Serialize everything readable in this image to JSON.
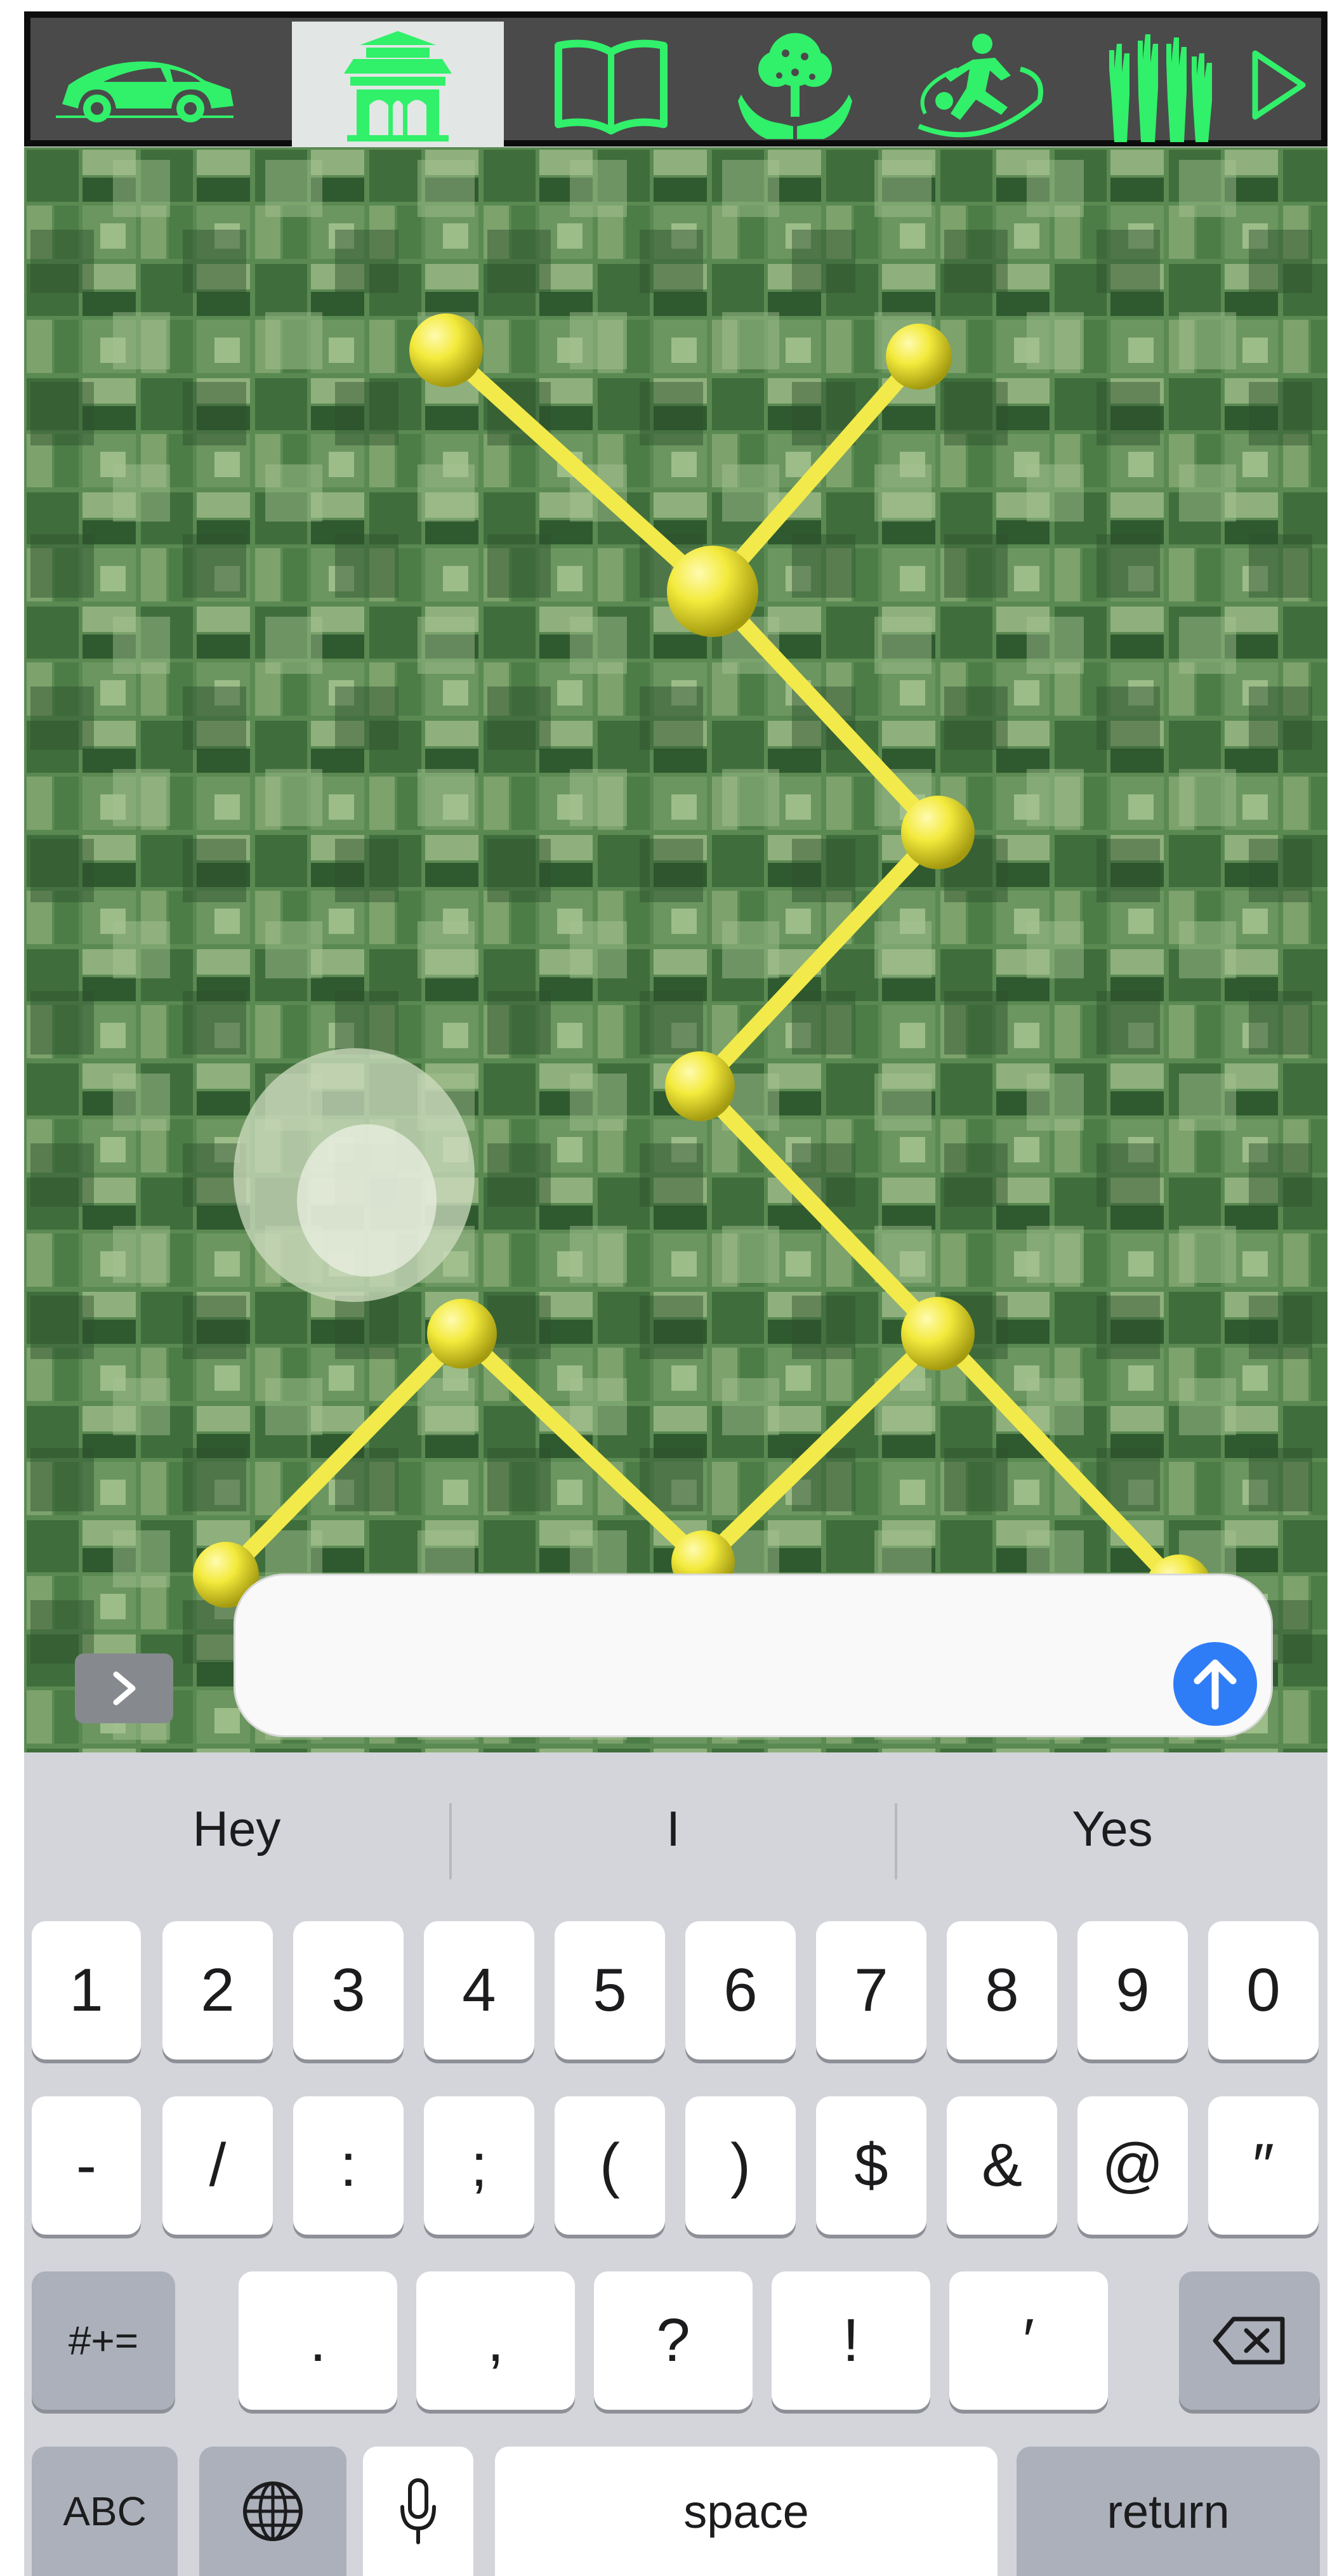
{
  "toolbar": {
    "items": [
      {
        "icon": "car-icon",
        "active": false
      },
      {
        "icon": "temple-icon",
        "active": true
      },
      {
        "icon": "book-icon",
        "active": false
      },
      {
        "icon": "tree-hands-icon",
        "active": false
      },
      {
        "icon": "athlete-icon",
        "active": false
      },
      {
        "icon": "raised-hands-icon",
        "active": false
      },
      {
        "icon": "play-icon",
        "active": false
      }
    ],
    "accent_color": "#31f06a",
    "background_color": "#4a4a4a"
  },
  "map": {
    "pattern_color": "#f2ea4a",
    "background_color": "#54844f"
  },
  "message_bar": {
    "expand_icon": "chevron-right-icon",
    "input_value": "",
    "send_icon": "arrow-up-icon",
    "send_color": "#2f7df6"
  },
  "keyboard": {
    "suggestions": [
      "Hey",
      "I",
      "Yes"
    ],
    "row1": [
      "1",
      "2",
      "3",
      "4",
      "5",
      "6",
      "7",
      "8",
      "9",
      "0"
    ],
    "row2": [
      "-",
      "/",
      ":",
      ";",
      "(",
      ")",
      "$",
      "&",
      "@",
      "″"
    ],
    "row3": {
      "shift_label": "#+=",
      "keys": [
        ".",
        ",",
        "?",
        "!",
        "′"
      ],
      "delete_icon": "backspace-icon"
    },
    "row4": {
      "abc_label": "ABC",
      "globe_icon": "globe-icon",
      "mic_icon": "microphone-icon",
      "space_label": "space",
      "return_label": "return"
    }
  }
}
